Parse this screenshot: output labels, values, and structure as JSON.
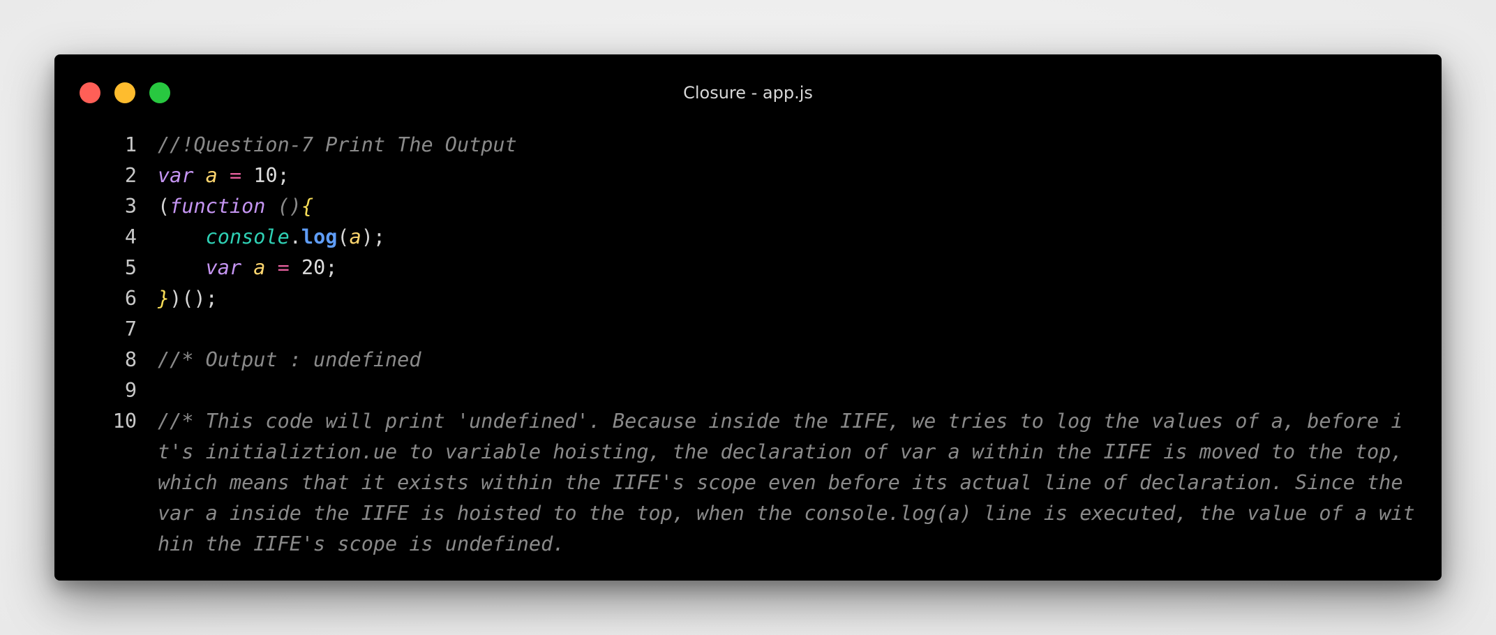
{
  "window": {
    "title": "Closure - app.js",
    "buttons": [
      {
        "name": "close",
        "color": "#ff5f57"
      },
      {
        "name": "minimize",
        "color": "#febc2e"
      },
      {
        "name": "maximize",
        "color": "#28c840"
      }
    ]
  },
  "colors": {
    "background": "#000000",
    "keyword": "#c595f2",
    "variable": "#ffd76f",
    "operator": "#e35f9c",
    "object": "#2fd1b5",
    "function": "#5f9df7",
    "comment": "#8a8a8a"
  },
  "code": {
    "line_numbers": [
      "1",
      "2",
      "3",
      "4",
      "5",
      "6",
      "7",
      "8",
      "9",
      "10"
    ],
    "lines": [
      [
        {
          "t": "//!Question-7 Print The Output",
          "c": "cm"
        }
      ],
      [
        {
          "t": "var",
          "c": "kw"
        },
        {
          "t": " ",
          "c": "pun"
        },
        {
          "t": "a",
          "c": "var"
        },
        {
          "t": " ",
          "c": "pun"
        },
        {
          "t": "=",
          "c": "op"
        },
        {
          "t": " ",
          "c": "pun"
        },
        {
          "t": "10",
          "c": "num"
        },
        {
          "t": ";",
          "c": "pun"
        }
      ],
      [
        {
          "t": "(",
          "c": "pun"
        },
        {
          "t": "function",
          "c": "kw"
        },
        {
          "t": " ",
          "c": "pun"
        },
        {
          "t": "()",
          "c": "par"
        },
        {
          "t": "{",
          "c": "brace"
        }
      ],
      [
        {
          "t": "    ",
          "c": "pun"
        },
        {
          "t": "console",
          "c": "obj"
        },
        {
          "t": ".",
          "c": "pun"
        },
        {
          "t": "log",
          "c": "fn"
        },
        {
          "t": "(",
          "c": "pun"
        },
        {
          "t": "a",
          "c": "var"
        },
        {
          "t": ");",
          "c": "pun"
        }
      ],
      [
        {
          "t": "    ",
          "c": "pun"
        },
        {
          "t": "var",
          "c": "kw"
        },
        {
          "t": " ",
          "c": "pun"
        },
        {
          "t": "a",
          "c": "var"
        },
        {
          "t": " ",
          "c": "pun"
        },
        {
          "t": "=",
          "c": "op"
        },
        {
          "t": " ",
          "c": "pun"
        },
        {
          "t": "20",
          "c": "num"
        },
        {
          "t": ";",
          "c": "pun"
        }
      ],
      [
        {
          "t": "}",
          "c": "brace"
        },
        {
          "t": ")();",
          "c": "pun"
        }
      ],
      [],
      [
        {
          "t": "//* Output : undefined",
          "c": "cm"
        }
      ],
      [],
      []
    ],
    "wrapped_comment": [
      "//* This code will print 'undefined'. Because inside the IIFE, we tries to log the values of a, before i",
      "t's initializtion.ue to variable hoisting, the declaration of var a within the IIFE is moved to the top,",
      "which means that it exists within the IIFE's scope even before its actual line of declaration. Since the",
      "var a inside the IIFE is hoisted to the top, when the console.log(a) line is executed, the value of a wit",
      "hin the IIFE's scope is undefined."
    ]
  }
}
